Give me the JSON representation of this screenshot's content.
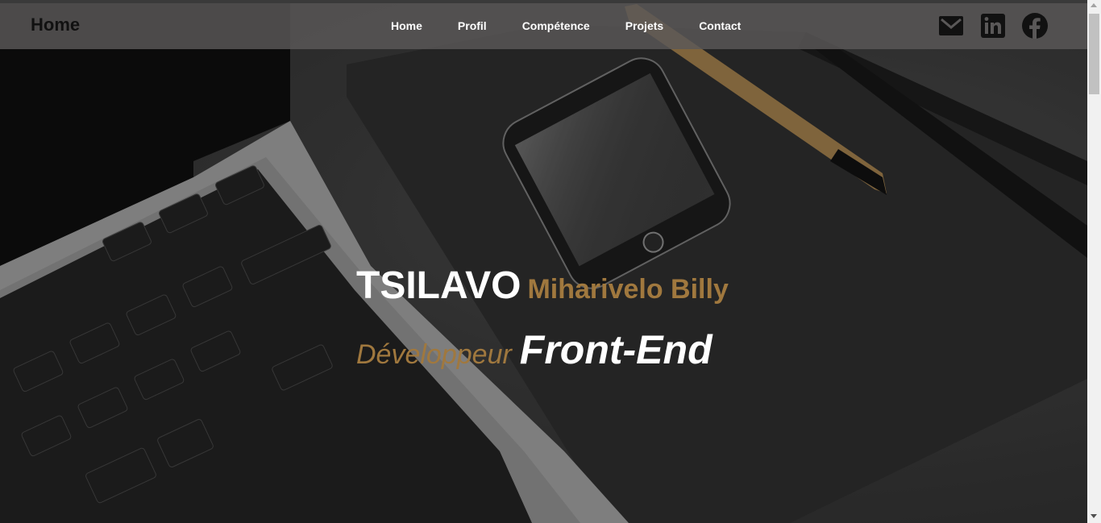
{
  "nav": {
    "brand": "Home",
    "links": [
      "Home",
      "Profil",
      "Compétence",
      "Projets",
      "Contact"
    ]
  },
  "socials": [
    {
      "icon": "gmail-icon"
    },
    {
      "icon": "linkedin-icon"
    },
    {
      "icon": "facebook-icon"
    }
  ],
  "hero": {
    "first_name": "TSILAVO",
    "last_name": "Miharivelo Billy",
    "role_1": "Développeur",
    "role_2": "Front-End"
  },
  "colors": {
    "accent": "#a0783e",
    "nav_bg": "#5a5858",
    "text_light": "#ffffff",
    "brand_text": "#111111"
  }
}
